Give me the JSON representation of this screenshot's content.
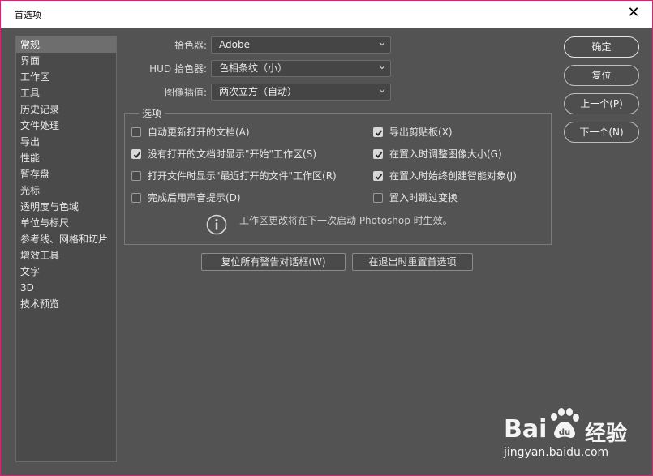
{
  "window": {
    "title": "首选项"
  },
  "sidebar": {
    "items": [
      {
        "label": "常规",
        "selected": true
      },
      {
        "label": "界面"
      },
      {
        "label": "工作区"
      },
      {
        "label": "工具"
      },
      {
        "label": "历史记录"
      },
      {
        "label": "文件处理"
      },
      {
        "label": "导出"
      },
      {
        "label": "性能"
      },
      {
        "label": "暂存盘"
      },
      {
        "label": "光标"
      },
      {
        "label": "透明度与色域"
      },
      {
        "label": "单位与标尺"
      },
      {
        "label": "参考线、网格和切片"
      },
      {
        "label": "增效工具"
      },
      {
        "label": "文字"
      },
      {
        "label": "3D"
      },
      {
        "label": "技术预览"
      }
    ]
  },
  "fields": {
    "color_picker": {
      "label": "拾色器:",
      "value": "Adobe"
    },
    "hud_picker": {
      "label": "HUD 拾色器:",
      "value": "色相条纹（小）"
    },
    "interpolation": {
      "label": "图像插值:",
      "value": "两次立方（自动）"
    }
  },
  "options": {
    "title": "选项",
    "auto_update": {
      "label": "自动更新打开的文档(A)",
      "checked": false
    },
    "show_start": {
      "label": "没有打开的文档时显示\"开始\"工作区(S)",
      "checked": true
    },
    "show_recent": {
      "label": "打开文件时显示\"最近打开的文件\"工作区(R)",
      "checked": false
    },
    "beep": {
      "label": "完成后用声音提示(D)",
      "checked": false
    },
    "export_clipboard": {
      "label": "导出剪贴板(X)",
      "checked": true
    },
    "resize_on_place": {
      "label": "在置入时调整图像大小(G)",
      "checked": true
    },
    "smart_object": {
      "label": "在置入时始终创建智能对象(J)",
      "checked": true
    },
    "skip_transform": {
      "label": "置入时跳过变换",
      "checked": false
    },
    "info": "工作区更改将在下一次启动 Photoshop 时生效。"
  },
  "buttons": {
    "reset_warnings": "复位所有警告对话框(W)",
    "reset_prefs": "在退出时重置首选项",
    "ok": "确定",
    "reset": "复位",
    "prev": "上一个(P)",
    "next": "下一个(N)"
  },
  "watermark": {
    "brand": "Bai",
    "brand2": "经验",
    "url": "jingyan.baidu.com"
  },
  "colors": {
    "accent_border": "#c0306f",
    "panel_bg": "#535353"
  }
}
